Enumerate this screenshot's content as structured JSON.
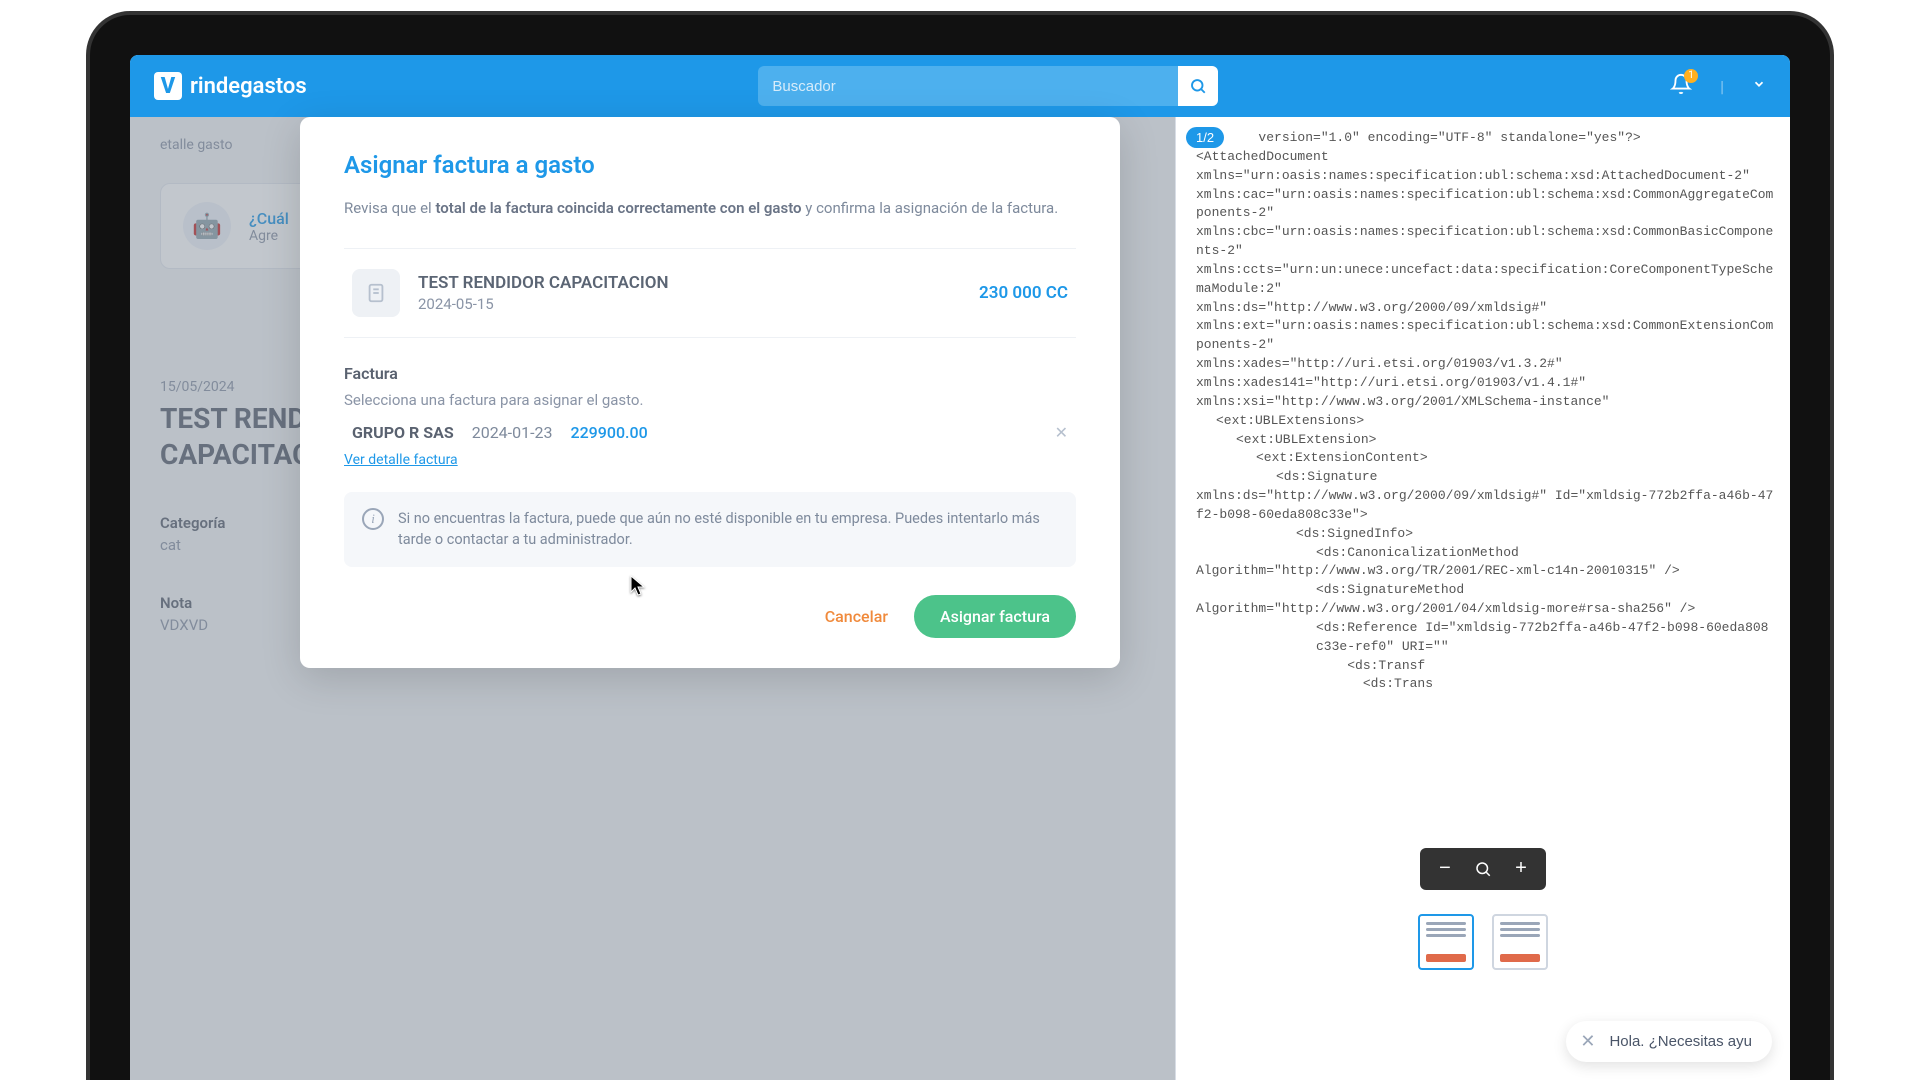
{
  "brand": "rindegastos",
  "search": {
    "placeholder": "Buscador"
  },
  "notifications": {
    "count": "1"
  },
  "background": {
    "crumb": "etalle gasto",
    "bot_title": "¿Cuál",
    "bot_sub": "Agre",
    "detail_date": "15/05/2024",
    "detail_title": "TEST RENDIDOR CAPACITACION",
    "category_label": "Categoría",
    "category_value": "cat",
    "note_label": "Nota",
    "note_value": "VDXVD"
  },
  "modal": {
    "title": "Asignar factura a gasto",
    "intro_a": "Revisa que el ",
    "intro_b": "total de la factura coincida correctamente con el gasto",
    "intro_c": " y confirma la asignación de la factura.",
    "expense": {
      "name": "TEST RENDIDOR CAPACITACION",
      "date": "2024-05-15",
      "amount": "230 000 CC"
    },
    "invoice_section_label": "Factura",
    "invoice_section_sub": "Selecciona una factura para asignar el gasto.",
    "invoice": {
      "company": "GRUPO R SAS",
      "date": "2024-01-23",
      "amount": "229900.00",
      "detail_link": "Ver detalle factura"
    },
    "info_text": "Si no encuentras la factura, puede que aún no esté disponible en tu empresa. Puedes intentarlo más tarde o contactar a tu administrador.",
    "cancel": "Cancelar",
    "assign": "Asignar factura"
  },
  "preview": {
    "page_indicator": "1/2",
    "xml_lines": [
      {
        "i": 0,
        "t": "        version=\"1.0\" encoding=\"UTF-8\" standalone=\"yes\"?>"
      },
      {
        "i": 0,
        "t": "<AttachedDocument"
      },
      {
        "i": 0,
        "t": "xmlns=\"urn:oasis:names:specification:ubl:schema:xsd:AttachedDocument-2\""
      },
      {
        "i": 0,
        "t": "xmlns:cac=\"urn:oasis:names:specification:ubl:schema:xsd:CommonAggregateComponents-2\""
      },
      {
        "i": 0,
        "t": "xmlns:cbc=\"urn:oasis:names:specification:ubl:schema:xsd:CommonBasicComponents-2\""
      },
      {
        "i": 0,
        "t": "xmlns:ccts=\"urn:un:unece:uncefact:data:specification:CoreComponentTypeSchemaModule:2\""
      },
      {
        "i": 0,
        "t": "xmlns:ds=\"http://www.w3.org/2000/09/xmldsig#\""
      },
      {
        "i": 0,
        "t": "xmlns:ext=\"urn:oasis:names:specification:ubl:schema:xsd:CommonExtensionComponents-2\""
      },
      {
        "i": 0,
        "t": "xmlns:xades=\"http://uri.etsi.org/01903/v1.3.2#\""
      },
      {
        "i": 0,
        "t": "xmlns:xades141=\"http://uri.etsi.org/01903/v1.4.1#\""
      },
      {
        "i": 0,
        "t": "xmlns:xsi=\"http://www.w3.org/2001/XMLSchema-instance\""
      },
      {
        "i": 1,
        "t": "<ext:UBLExtensions>"
      },
      {
        "i": 2,
        "t": "<ext:UBLExtension>"
      },
      {
        "i": 3,
        "t": "<ext:ExtensionContent>"
      },
      {
        "i": 4,
        "t": "<ds:Signature"
      },
      {
        "i": 0,
        "t": "xmlns:ds=\"http://www.w3.org/2000/09/xmldsig#\" Id=\"xmldsig-772b2ffa-a46b-47f2-b098-60eda808c33e\">"
      },
      {
        "i": 5,
        "t": "<ds:SignedInfo>"
      },
      {
        "i": 6,
        "t": "<ds:CanonicalizationMethod"
      },
      {
        "i": 0,
        "t": "Algorithm=\"http://www.w3.org/TR/2001/REC-xml-c14n-20010315\" />"
      },
      {
        "i": 6,
        "t": "<ds:SignatureMethod"
      },
      {
        "i": 0,
        "t": "Algorithm=\"http://www.w3.org/2001/04/xmldsig-more#rsa-sha256\" />"
      },
      {
        "i": 6,
        "t": "<ds:Reference Id=\"xmldsig-772b2ffa-a46b-47f2-b098-60eda808c33e-ref0\" URI=\"\""
      },
      {
        "i": 6,
        "t": "    <ds:Transf"
      },
      {
        "i": 6,
        "t": "      <ds:Trans"
      }
    ],
    "chat_text": "Hola. ¿Necesitas ayu"
  }
}
